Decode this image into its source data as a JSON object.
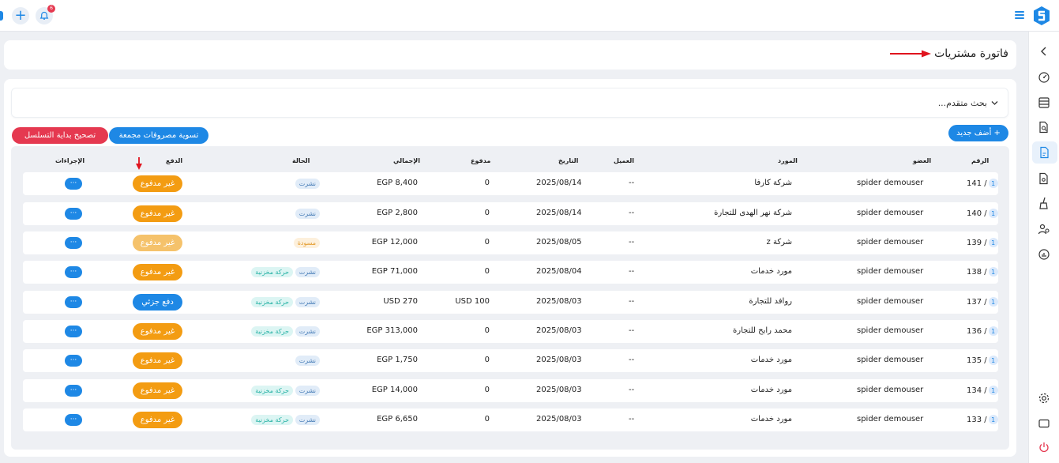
{
  "topbar": {
    "notification_count": "6"
  },
  "page": {
    "title": "فاتورة مشتريات"
  },
  "search": {
    "label": "بحث متقدم..."
  },
  "buttons": {
    "add_new": "+ أضف جديد",
    "settle_expenses": "تسوية مصروفات مجمعة",
    "fix_sequence": "تصحيح بداية التسلسل"
  },
  "table": {
    "headers": {
      "number": "الرقم",
      "member": "العضو",
      "supplier": "المورد",
      "client": "العميل",
      "date": "التاريخ",
      "paid": "مدفوع",
      "total": "الإجمالي",
      "status": "الحالة",
      "payment": "الدفع",
      "actions": "الإجراءات"
    },
    "rows": [
      {
        "badge": "1",
        "number": "141 /",
        "member": "spider demouser",
        "supplier": "شركة كارفا",
        "client": "--",
        "date": "2025/08/14",
        "paid": "0",
        "total": "EGP 8,400",
        "status_main": "نشرت",
        "status_extra": "",
        "payment": "غير مدفوع",
        "payment_kind": "unpaid",
        "actions": "···"
      },
      {
        "badge": "1",
        "number": "140 /",
        "member": "spider demouser",
        "supplier": "شركة  نهر الهدى للتجارة",
        "client": "--",
        "date": "2025/08/14",
        "paid": "0",
        "total": "EGP 2,800",
        "status_main": "نشرت",
        "status_extra": "",
        "payment": "غير مدفوع",
        "payment_kind": "unpaid",
        "actions": "···"
      },
      {
        "badge": "1",
        "number": "139 /",
        "member": "spider demouser",
        "supplier": "شركة z",
        "client": "--",
        "date": "2025/08/05",
        "paid": "0",
        "total": "EGP 12,000",
        "status_main": "مسودة",
        "status_extra": "",
        "payment": "غير مدفوع",
        "payment_kind": "unpaid-draft",
        "actions": "···"
      },
      {
        "badge": "1",
        "number": "138 /",
        "member": "spider demouser",
        "supplier": "مورد خدمات",
        "client": "--",
        "date": "2025/08/04",
        "paid": "0",
        "total": "EGP 71,000",
        "status_main": "نشرت",
        "status_extra": "حركة مخزنية",
        "payment": "غير مدفوع",
        "payment_kind": "unpaid",
        "actions": "···"
      },
      {
        "badge": "1",
        "number": "137 /",
        "member": "spider demouser",
        "supplier": "روافد للتجارة",
        "client": "--",
        "date": "2025/08/03",
        "paid": "USD 100",
        "total": "USD 270",
        "status_main": "نشرت",
        "status_extra": "حركة مخزنية",
        "payment": "دفع جزئي",
        "payment_kind": "partial",
        "actions": "···"
      },
      {
        "badge": "1",
        "number": "136 /",
        "member": "spider demouser",
        "supplier": "محمد رابح للتجارة",
        "client": "--",
        "date": "2025/08/03",
        "paid": "0",
        "total": "EGP 313,000",
        "status_main": "نشرت",
        "status_extra": "حركة مخزنية",
        "payment": "غير مدفوع",
        "payment_kind": "unpaid",
        "actions": "···"
      },
      {
        "badge": "1",
        "number": "135 /",
        "member": "spider demouser",
        "supplier": "مورد خدمات",
        "client": "--",
        "date": "2025/08/03",
        "paid": "0",
        "total": "EGP 1,750",
        "status_main": "نشرت",
        "status_extra": "",
        "payment": "غير مدفوع",
        "payment_kind": "unpaid",
        "actions": "···"
      },
      {
        "badge": "1",
        "number": "134 /",
        "member": "spider demouser",
        "supplier": "مورد خدمات",
        "client": "--",
        "date": "2025/08/03",
        "paid": "0",
        "total": "EGP 14,000",
        "status_main": "نشرت",
        "status_extra": "حركة مخزنية",
        "payment": "غير مدفوع",
        "payment_kind": "unpaid",
        "actions": "···"
      },
      {
        "badge": "1",
        "number": "133 /",
        "member": "spider demouser",
        "supplier": "مورد خدمات",
        "client": "--",
        "date": "2025/08/03",
        "paid": "0",
        "total": "EGP 6,650",
        "status_main": "نشرت",
        "status_extra": "حركة مخزنية",
        "payment": "غير مدفوع",
        "payment_kind": "unpaid",
        "actions": "···"
      }
    ]
  },
  "colors": {
    "accent": "#1e88e5",
    "danger": "#e53950",
    "unpaid": "#f39c12",
    "annotation_arrow": "#e0141e"
  },
  "icons": {
    "topbar": [
      "plus-icon",
      "bell-icon",
      "menu-icon",
      "app-logo-icon"
    ],
    "sidebar": [
      "chevron-left-icon",
      "speedometer-icon",
      "database-icon",
      "document-search-icon",
      "document-active-icon",
      "document-settings-icon",
      "broom-icon",
      "users-settings-icon",
      "report-chart-icon",
      "gear-icon",
      "window-icon",
      "power-icon"
    ]
  }
}
